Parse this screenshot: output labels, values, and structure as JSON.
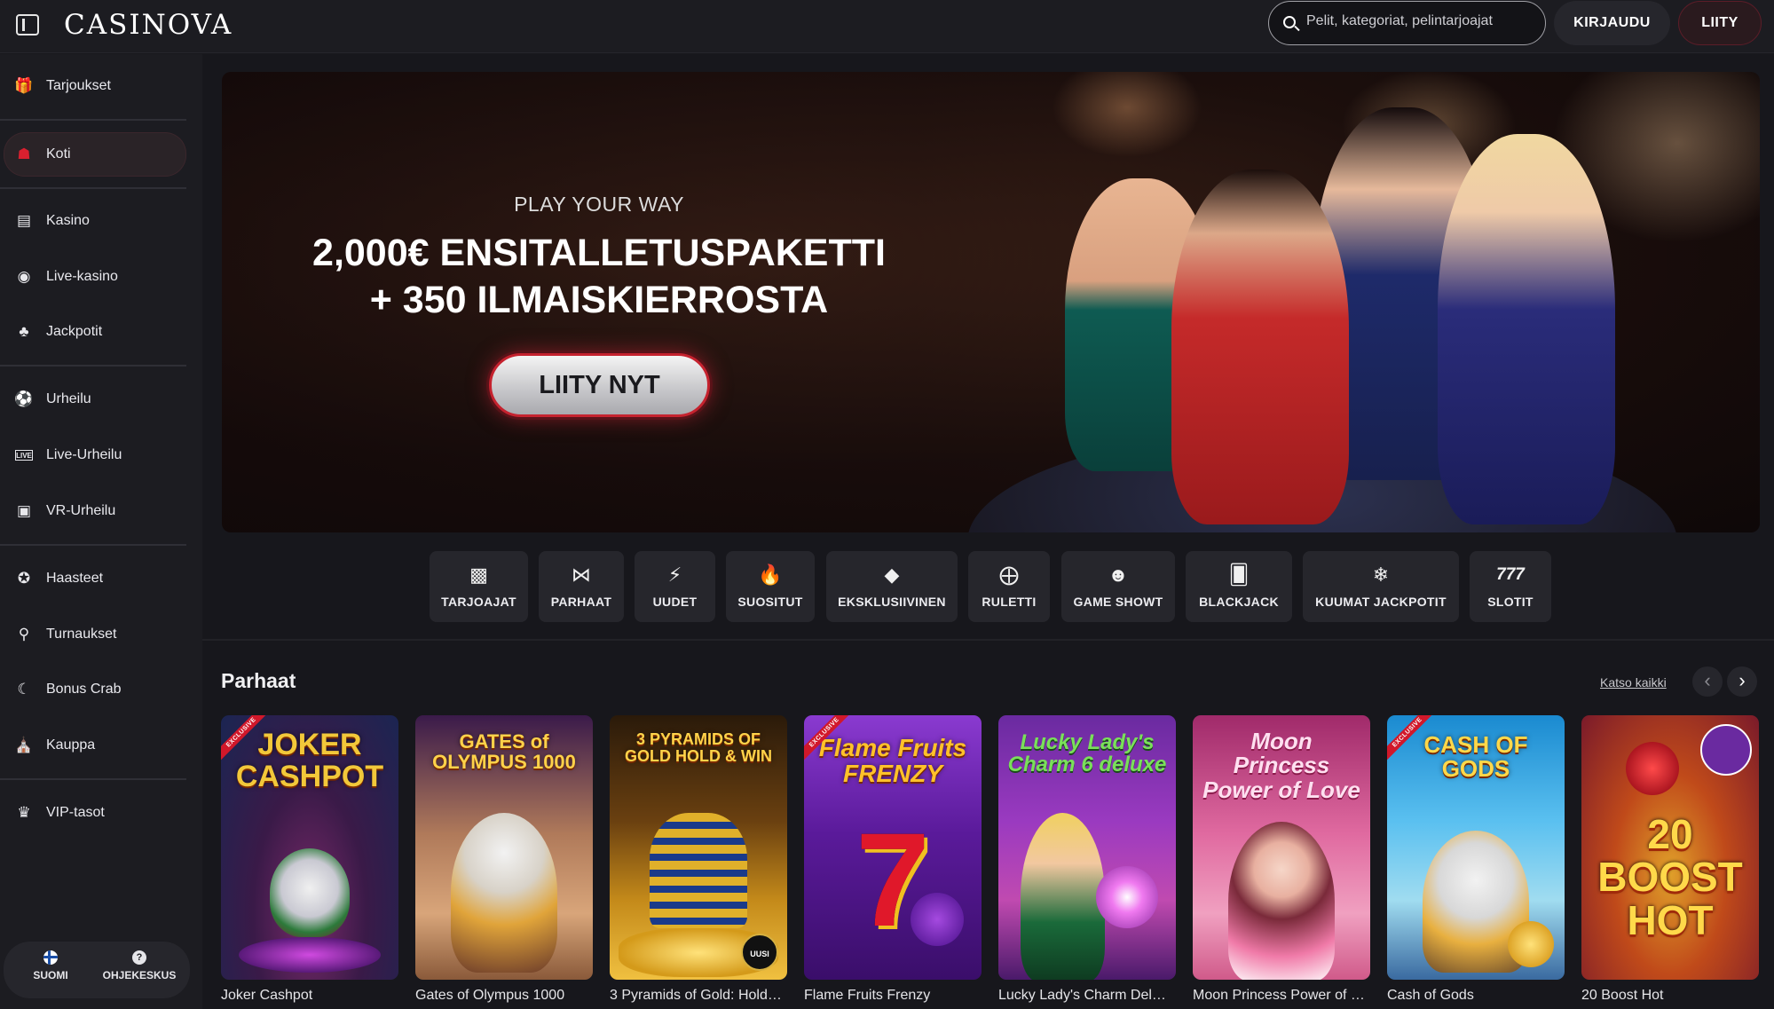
{
  "header": {
    "logo": "CASINOVA",
    "search_placeholder": "Pelit, kategoriat, pelintarjoajat",
    "login_label": "KIRJAUDU",
    "join_label": "LIITY"
  },
  "sidebar": {
    "items": [
      {
        "label": "Tarjoukset",
        "icon": "gift-icon"
      },
      {
        "label": "Koti",
        "icon": "home-icon"
      },
      {
        "label": "Kasino",
        "icon": "slot-machine-icon"
      },
      {
        "label": "Live-kasino",
        "icon": "live-dealer-icon"
      },
      {
        "label": "Jackpotit",
        "icon": "clover-icon"
      },
      {
        "label": "Urheilu",
        "icon": "football-icon"
      },
      {
        "label": "Live-Urheilu",
        "icon": "live-tag-icon"
      },
      {
        "label": "VR-Urheilu",
        "icon": "vr-icon"
      },
      {
        "label": "Haasteet",
        "icon": "medal-icon"
      },
      {
        "label": "Turnaukset",
        "icon": "trophy-icon"
      },
      {
        "label": "Bonus Crab",
        "icon": "crab-claw-icon"
      },
      {
        "label": "Kauppa",
        "icon": "shop-icon"
      },
      {
        "label": "VIP-tasot",
        "icon": "crown-icon"
      }
    ],
    "active": "Koti",
    "footer": {
      "language_label": "SUOMI",
      "help_label": "OHJEKESKUS"
    }
  },
  "hero": {
    "subtitle": "PLAY YOUR WAY",
    "title_line1": "2,000€ ENSITALLETUSPAKETTI",
    "title_line2": "+ 350 ILMAISKIERROSTA",
    "cta_label": "LIITY NYT"
  },
  "categories": [
    {
      "label": "TARJOAJAT",
      "icon": "provider-icon"
    },
    {
      "label": "PARHAAT",
      "icon": "bowtie-icon"
    },
    {
      "label": "UUDET",
      "icon": "lightning-icon"
    },
    {
      "label": "SUOSITUT",
      "icon": "flame-icon"
    },
    {
      "label": "EKSKLUSIIVINEN",
      "icon": "diamond-icon"
    },
    {
      "label": "RULETTI",
      "icon": "roulette-icon"
    },
    {
      "label": "GAME SHOWT",
      "icon": "mask-icon"
    },
    {
      "label": "BLACKJACK",
      "icon": "cards-icon"
    },
    {
      "label": "KUUMAT JACKPOTIT",
      "icon": "hot-jackpot-icon"
    },
    {
      "label": "SLOTIT",
      "icon": "seven-icon"
    }
  ],
  "games_section": {
    "title": "Parhaat",
    "see_all": "Katso kaikki",
    "games": [
      {
        "name": "Joker Cashpot",
        "exclusive": true,
        "logo": "JOKER CASHPOT"
      },
      {
        "name": "Gates of Olympus 1000",
        "exclusive": false,
        "logo": "GATES of OLYMPUS 1000"
      },
      {
        "name": "3 Pyramids of Gold: Hold…",
        "exclusive": false,
        "logo": "3 PYRAMIDS OF GOLD HOLD & WIN",
        "badge": "UUSI"
      },
      {
        "name": "Flame Fruits Frenzy",
        "exclusive": true,
        "logo": "Flame Fruits FRENZY"
      },
      {
        "name": "Lucky Lady's Charm Del…",
        "exclusive": false,
        "logo": "Lucky Lady's Charm 6 deluxe"
      },
      {
        "name": "Moon Princess Power of …",
        "exclusive": false,
        "logo": "Moon Princess Power of Love"
      },
      {
        "name": "Cash of Gods",
        "exclusive": true,
        "logo": "CASH OF GODS"
      },
      {
        "name": "20 Boost Hot",
        "exclusive": false,
        "logo": "20 BOOST HOT"
      }
    ]
  },
  "colors": {
    "background": "#17171c",
    "panel": "#1c1c21",
    "accent": "#d1182a"
  }
}
